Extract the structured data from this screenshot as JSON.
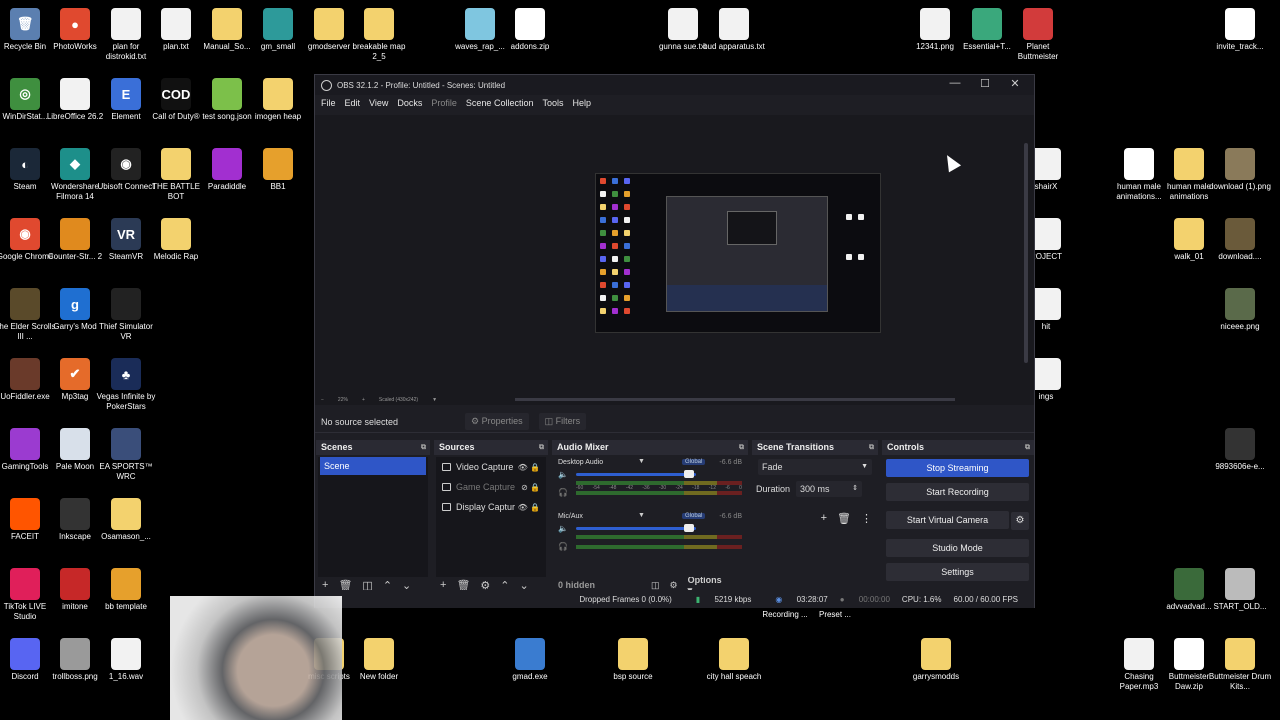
{
  "desktop": {
    "icons": [
      {
        "label": "Recycle Bin",
        "glyph": "🗑",
        "kind": "app",
        "color": "#5b7fb0"
      },
      {
        "label": "PhotoWorks",
        "glyph": "●",
        "kind": "app",
        "color": "#e0492f"
      },
      {
        "label": "plan for distrokid.txt",
        "glyph": "",
        "kind": "file",
        "color": "#f2f2f2"
      },
      {
        "label": "plan.txt",
        "glyph": "",
        "kind": "file",
        "color": "#f2f2f2"
      },
      {
        "label": "Manual_So...",
        "glyph": "",
        "kind": "folder",
        "color": "#f3d26e"
      },
      {
        "label": "gm_small",
        "glyph": "",
        "kind": "app",
        "color": "#2d9a9a"
      },
      {
        "label": "gmodserver",
        "glyph": "",
        "kind": "folder",
        "color": "#f3d26e"
      },
      {
        "label": "breakable map 2_5",
        "glyph": "",
        "kind": "folder",
        "color": "#f3d26e"
      },
      {
        "label": "waves_rap_...",
        "glyph": "",
        "kind": "app",
        "color": "#7fc6e0"
      },
      {
        "label": "addons.zip",
        "glyph": "7z",
        "kind": "7z",
        "color": "#ffffff"
      },
      {
        "label": "gunna sue.txt",
        "glyph": "",
        "kind": "file",
        "color": "#f2f2f2"
      },
      {
        "label": "bud apparatus.txt",
        "glyph": "",
        "kind": "file",
        "color": "#f2f2f2"
      },
      {
        "label": "12341.png",
        "glyph": "",
        "kind": "file",
        "color": "#f2f2f2"
      },
      {
        "label": "Essential+T...",
        "glyph": "",
        "kind": "app",
        "color": "#3aa87c"
      },
      {
        "label": "Planet Buttmeister",
        "glyph": "",
        "kind": "app",
        "color": "#d23b3b"
      },
      {
        "label": "invite_track...",
        "glyph": "7z",
        "kind": "7z",
        "color": "#ffffff"
      },
      {
        "label": "WinDirStat...",
        "glyph": "◎",
        "kind": "app",
        "color": "#3f8f3f"
      },
      {
        "label": "LibreOffice 26.2",
        "glyph": "",
        "kind": "file",
        "color": "#f2f2f2"
      },
      {
        "label": "Element",
        "glyph": "E",
        "kind": "app",
        "color": "#3a6fd8"
      },
      {
        "label": "Call of Duty®",
        "glyph": "COD",
        "kind": "app",
        "color": "#111111"
      },
      {
        "label": "test song.json",
        "glyph": "",
        "kind": "app",
        "color": "#7cc04a"
      },
      {
        "label": "imogen heap",
        "glyph": "",
        "kind": "folder",
        "color": "#f3d26e"
      },
      {
        "label": "Steam",
        "glyph": "◐",
        "kind": "app",
        "color": "#1b2838"
      },
      {
        "label": "Wondershare Filmora 14",
        "glyph": "◆",
        "kind": "app",
        "color": "#1d8f8a"
      },
      {
        "label": "Ubisoft Connect",
        "glyph": "◉",
        "kind": "app",
        "color": "#222222"
      },
      {
        "label": "THE BATTLE BOT",
        "glyph": "",
        "kind": "folder",
        "color": "#f3d26e"
      },
      {
        "label": "Paradiddle",
        "glyph": "",
        "kind": "app",
        "color": "#a22fd0"
      },
      {
        "label": "BB1",
        "glyph": "",
        "kind": "app",
        "color": "#e6a02c"
      },
      {
        "label": "Google Chrome",
        "glyph": "◉",
        "kind": "app",
        "color": "#e0492f"
      },
      {
        "label": "Counter-Str... 2",
        "glyph": "",
        "kind": "app",
        "color": "#e08a1e"
      },
      {
        "label": "SteamVR",
        "glyph": "VR",
        "kind": "app",
        "color": "#2b3a55"
      },
      {
        "label": "Melodic Rap",
        "glyph": "",
        "kind": "folder",
        "color": "#f3d26e"
      },
      {
        "label": "The Elder Scrolls III ...",
        "glyph": "",
        "kind": "app",
        "color": "#5a4a2a"
      },
      {
        "label": "Garry's Mod",
        "glyph": "g",
        "kind": "app",
        "color": "#1f6fd1"
      },
      {
        "label": "Thief Simulator VR",
        "glyph": "",
        "kind": "app",
        "color": "#222222"
      },
      {
        "label": "UoFiddler.exe",
        "glyph": "",
        "kind": "app",
        "color": "#6a3a2a"
      },
      {
        "label": "Mp3tag",
        "glyph": "✔",
        "kind": "app",
        "color": "#e56b2a"
      },
      {
        "label": "Vegas Infinite by PokerStars",
        "glyph": "♣",
        "kind": "app",
        "color": "#1a2c58"
      },
      {
        "label": "GamingTools",
        "glyph": "",
        "kind": "app",
        "color": "#9b3bd0"
      },
      {
        "label": "Pale Moon",
        "glyph": "",
        "kind": "app",
        "color": "#d8e0ea"
      },
      {
        "label": "EA SPORTS™ WRC",
        "glyph": "",
        "kind": "app",
        "color": "#3a4e7a"
      },
      {
        "label": "FACEIT",
        "glyph": "",
        "kind": "app",
        "color": "#ff5500"
      },
      {
        "label": "Inkscape",
        "glyph": "",
        "kind": "app",
        "color": "#333333"
      },
      {
        "label": "Osamason_...",
        "glyph": "",
        "kind": "folder",
        "color": "#f3d26e"
      },
      {
        "label": "TikTok LIVE Studio",
        "glyph": "",
        "kind": "app",
        "color": "#e01f5a"
      },
      {
        "label": "imitone",
        "glyph": "",
        "kind": "app",
        "color": "#c62828"
      },
      {
        "label": "bb template",
        "glyph": "",
        "kind": "app",
        "color": "#e6a02c"
      },
      {
        "label": "Discord",
        "glyph": "",
        "kind": "app",
        "color": "#5865f2"
      },
      {
        "label": "trollboss.png",
        "glyph": "",
        "kind": "app",
        "color": "#9a9a9a"
      },
      {
        "label": "1_16.wav",
        "glyph": "",
        "kind": "file",
        "color": "#f2f2f2"
      },
      {
        "label": "misc scripts",
        "glyph": "",
        "kind": "folder",
        "color": "#f3d26e"
      },
      {
        "label": "New folder",
        "glyph": "",
        "kind": "folder",
        "color": "#f3d26e"
      },
      {
        "label": "gmad.exe",
        "glyph": "",
        "kind": "app",
        "color": "#3a7cd0"
      },
      {
        "label": "bsp source",
        "glyph": "",
        "kind": "folder",
        "color": "#f3d26e"
      },
      {
        "label": "city hall speach",
        "glyph": "",
        "kind": "folder",
        "color": "#f3d26e"
      },
      {
        "label": "garrysmodds",
        "glyph": "",
        "kind": "folder",
        "color": "#f3d26e"
      },
      {
        "label": "Chasing Paper.mp3",
        "glyph": "",
        "kind": "file",
        "color": "#f2f2f2"
      },
      {
        "label": "Buttmeister Daw.zip",
        "glyph": "7z",
        "kind": "7z",
        "color": "#ffffff"
      },
      {
        "label": "Buttmeister Drum Kits...",
        "glyph": "",
        "kind": "folder",
        "color": "#f3d26e"
      },
      {
        "label": "human male animations...",
        "glyph": "7z",
        "kind": "7z",
        "color": "#ffffff"
      },
      {
        "label": "human male animations",
        "glyph": "",
        "kind": "folder",
        "color": "#f3d26e"
      },
      {
        "label": "download (1).png",
        "glyph": "",
        "kind": "app",
        "color": "#8a7a5a"
      },
      {
        "label": "walk_01",
        "glyph": "",
        "kind": "folder",
        "color": "#f3d26e"
      },
      {
        "label": "download....",
        "glyph": "",
        "kind": "app",
        "color": "#6a5a3a"
      },
      {
        "label": "niceee.png",
        "glyph": "",
        "kind": "app",
        "color": "#5a6a4a"
      },
      {
        "label": "9893606e-e...",
        "glyph": "",
        "kind": "app",
        "color": "#333333"
      },
      {
        "label": "advvadvad...",
        "glyph": "",
        "kind": "app",
        "color": "#3a6a3a"
      },
      {
        "label": "START_OLD...",
        "glyph": "",
        "kind": "app",
        "color": "#bbbbbb"
      },
      {
        "label": "Recording ...",
        "glyph": "",
        "kind": "file",
        "color": "#000000"
      },
      {
        "label": "Preset ...",
        "glyph": "",
        "kind": "file",
        "color": "#000000"
      },
      {
        "label": "shairX",
        "glyph": "",
        "kind": "file",
        "color": "#f2f2f2"
      },
      {
        "label": "ROJECT",
        "glyph": "",
        "kind": "file",
        "color": "#f2f2f2"
      },
      {
        "label": "hit",
        "glyph": "",
        "kind": "file",
        "color": "#f2f2f2"
      },
      {
        "label": "ings",
        "glyph": "",
        "kind": "file",
        "color": "#f2f2f2"
      }
    ]
  },
  "obs": {
    "title": "OBS 32.1.2 - Profile: Untitled - Scenes: Untitled",
    "window_buttons": {
      "minimize": "—",
      "maximize": "☐",
      "close": "✕"
    },
    "menu": [
      "File",
      "Edit",
      "View",
      "Docks",
      "Profile",
      "Scene Collection",
      "Tools",
      "Help"
    ],
    "preview_bar": {
      "zoom": "22%",
      "scale": "Scaled (430x242)"
    },
    "source_bar": {
      "status": "No source selected",
      "properties": "Properties",
      "filters": "Filters"
    },
    "scenes": {
      "title": "Scenes",
      "items": [
        "Scene"
      ]
    },
    "sources": {
      "title": "Sources",
      "items": [
        {
          "name": "Video Capture",
          "disabled": false
        },
        {
          "name": "Game Capture",
          "disabled": true
        },
        {
          "name": "Display Captur",
          "disabled": false
        }
      ]
    },
    "mixer": {
      "title": "Audio Mixer",
      "channels": [
        {
          "name": "Desktop Audio",
          "tag": "Global",
          "db": "-6.6 dB",
          "level": 0.6
        },
        {
          "name": "Mic/Aux",
          "tag": "Global",
          "db": "-6.6 dB",
          "level": 0.6
        }
      ],
      "ticks": [
        "-60",
        "-54",
        "-48",
        "-42",
        "-36",
        "-30",
        "-24",
        "-18",
        "-12",
        "-6",
        "0"
      ],
      "hidden": "0 hidden",
      "options": "Options"
    },
    "transitions": {
      "title": "Scene Transitions",
      "type": "Fade",
      "duration_label": "Duration",
      "duration": "300 ms"
    },
    "controls": {
      "title": "Controls",
      "stop_streaming": "Stop Streaming",
      "start_recording": "Start Recording",
      "start_virtual_camera": "Start Virtual Camera",
      "studio_mode": "Studio Mode",
      "settings": "Settings"
    },
    "status": {
      "dropped": "Dropped Frames 0 (0.0%)",
      "kbps": "5219 kbps",
      "stream_time": "03:28:07",
      "rec_time": "00:00:00",
      "cpu": "CPU: 1.6%",
      "fps": "60.00 / 60.00 FPS"
    }
  },
  "colors": {
    "accent": "#2f56c7",
    "panel": "#1e1e24"
  }
}
